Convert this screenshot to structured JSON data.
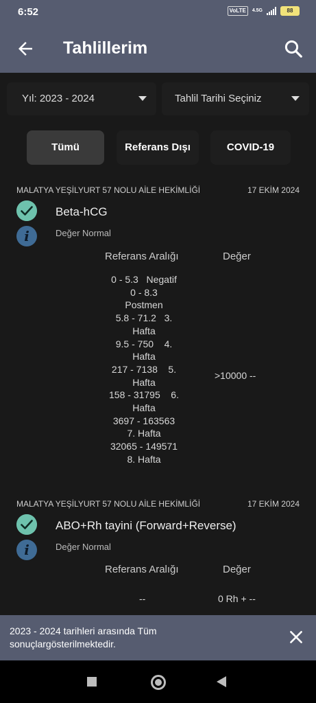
{
  "status_bar": {
    "time": "6:52",
    "chip": "VoLTE",
    "network": "4.5G",
    "battery": "88"
  },
  "app_bar": {
    "title": "Tahlillerim"
  },
  "filters": {
    "year": "Yıl: 2023 - 2024",
    "date": "Tahlil Tarihi Seçiniz"
  },
  "tabs": [
    {
      "label": "Tümü"
    },
    {
      "label": "Referans Dışı"
    },
    {
      "label": "COVID-19"
    }
  ],
  "results": [
    {
      "place": "MALATYA YEŞİLYURT 57 NOLU AİLE HEKİMLİĞİ",
      "date": "17 EKİM 2024",
      "test": "Beta-hCG",
      "status": "Değer Normal",
      "ref_header": "Referans Aralığı",
      "value_header": "Değer",
      "ref_lines": [
        "0 - 5.3   Negatif",
        "0 - 8.3",
        "Postmen",
        "5.8 - 71.2   3.",
        "Hafta",
        "9.5 - 750    4.",
        "Hafta",
        "217 - 7138    5.",
        "Hafta",
        "158 - 31795    6.",
        "Hafta",
        "3697 - 163563",
        "7. Hafta",
        "32065 - 149571",
        "8. Hafta"
      ],
      "value": ">10000 --"
    },
    {
      "place": "MALATYA YEŞİLYURT 57 NOLU AİLE HEKİMLİĞİ",
      "date": "17 EKİM 2024",
      "test": "ABO+Rh tayini (Forward+Reverse)",
      "status": "Değer Normal",
      "ref_header": "Referans Aralığı",
      "value_header": "Değer",
      "ref_value": "--",
      "value": "0 Rh + --"
    }
  ],
  "snackbar": {
    "message": "2023 - 2024 tarihleri arasında Tüm sonuçlargösterilmektedir."
  },
  "icons": {
    "back": "arrow-left-icon",
    "search": "search-icon",
    "check": "check-circle-icon",
    "info": "info-circle-icon",
    "close": "close-icon"
  },
  "colors": {
    "appbar": "#565c70",
    "background": "#191919",
    "check": "#6ec2ad",
    "info": "#3f6b95"
  }
}
